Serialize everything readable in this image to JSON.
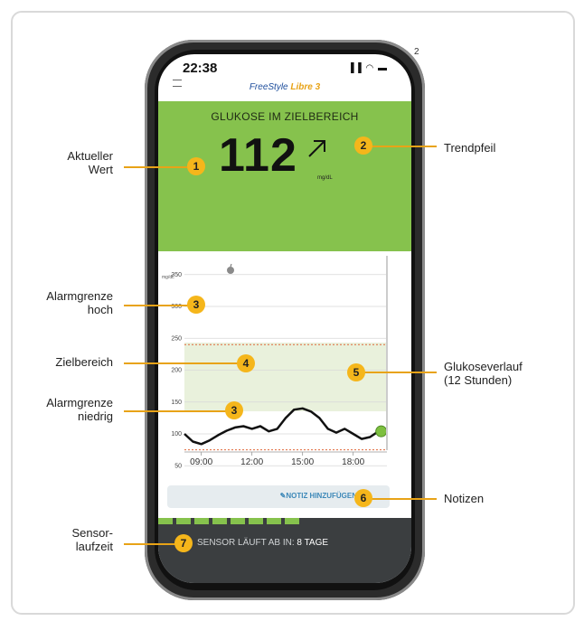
{
  "figure_number": "2",
  "phone": {
    "time": "22:38",
    "status_icons": "▐▐ ◠ ▬",
    "app_brand": "FreeStyle",
    "app_brand_accent": "Libre 3"
  },
  "glucose": {
    "status": "GLUKOSE IM ZIELBEREICH",
    "value": "112",
    "unit": "mg/dL",
    "trend": "arrow-up-right-icon",
    "color": "#86c24d"
  },
  "graph": {
    "y_unit": "mg/dL",
    "y_ticks": [
      "350",
      "300",
      "250",
      "200",
      "150",
      "100",
      "50"
    ],
    "x_ticks": [
      "09:00",
      "12:00",
      "15:00",
      "18:00"
    ],
    "alarm_high": 240,
    "alarm_low": 75,
    "target_range": [
      70,
      180
    ],
    "event_icon": "apple-icon"
  },
  "chart_data": {
    "type": "line",
    "x": [
      "08:00",
      "08:30",
      "09:00",
      "09:30",
      "10:00",
      "10:30",
      "11:00",
      "11:30",
      "12:00",
      "12:30",
      "13:00",
      "13:30",
      "14:00",
      "14:30",
      "15:00",
      "15:30",
      "16:00",
      "16:30",
      "17:00",
      "17:30",
      "18:00",
      "18:30",
      "19:00",
      "19:30"
    ],
    "series": [
      {
        "values": [
          100,
          88,
          84,
          90,
          98,
          105,
          110,
          112,
          108,
          112,
          104,
          108,
          125,
          138,
          140,
          135,
          125,
          108,
          102,
          108,
          100,
          92,
          95,
          104
        ]
      }
    ],
    "ylim": [
      0,
      350
    ]
  },
  "note": {
    "label": "NOTIZ HINZUFÜGEN"
  },
  "sensor": {
    "prefix": "SENSOR LÄUFT AB IN:",
    "value": "8 TAGE",
    "remaining_fraction": 0.57
  },
  "callouts": [
    {
      "n": "1",
      "text": "Aktueller\nWert"
    },
    {
      "n": "2",
      "text": "Trendpfeil"
    },
    {
      "n": "3",
      "text": "Alarmgrenze\nhoch"
    },
    {
      "n": "4",
      "text": "Zielbereich"
    },
    {
      "n": "3",
      "text": "Alarmgrenze\nniedrig"
    },
    {
      "n": "5",
      "text": "Glukoseverlauf\n(12 Stunden)"
    },
    {
      "n": "6",
      "text": "Notizen"
    },
    {
      "n": "7",
      "text": "Sensor-\nlaufzeit"
    }
  ]
}
